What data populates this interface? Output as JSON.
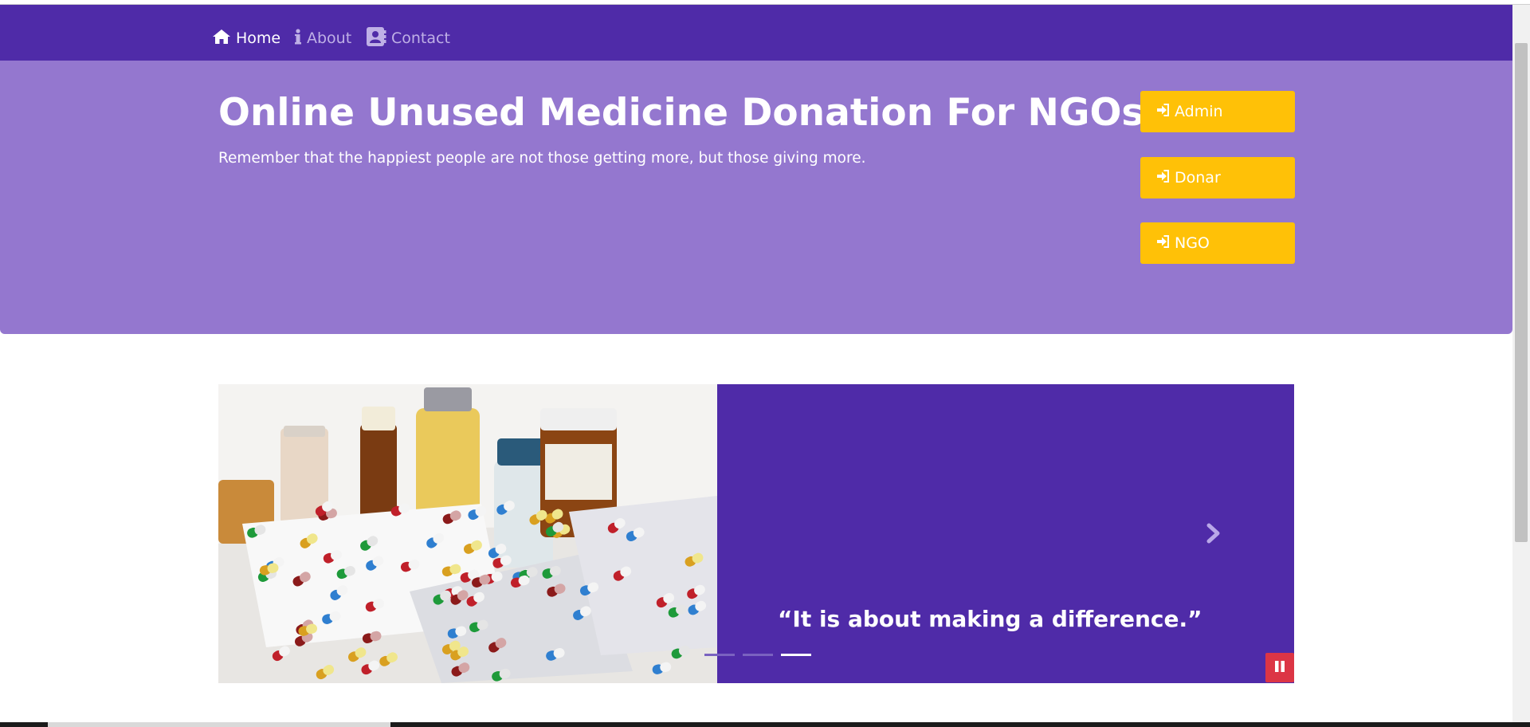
{
  "nav": {
    "items": [
      {
        "label": "Home",
        "icon": "home-icon",
        "active": true
      },
      {
        "label": "About",
        "icon": "info-icon",
        "active": false
      },
      {
        "label": "Contact",
        "icon": "contact-card-icon",
        "active": false
      }
    ]
  },
  "hero": {
    "title": "Online Unused Medicine Donation For NGOs",
    "subtitle": "Remember that the happiest people are not those getting more, but those giving more.",
    "buttons": [
      {
        "label": "Admin",
        "icon": "sign-in-icon"
      },
      {
        "label": "Donar",
        "icon": "sign-in-icon"
      },
      {
        "label": "NGO",
        "icon": "sign-in-icon"
      }
    ]
  },
  "carousel": {
    "quote": "“It is about making a difference.”",
    "slide_count": 3,
    "active_index": 2
  },
  "colors": {
    "navbar": "#4f2ba8",
    "hero": "#9477cf",
    "button": "#ffc107",
    "pause": "#dc3545"
  }
}
